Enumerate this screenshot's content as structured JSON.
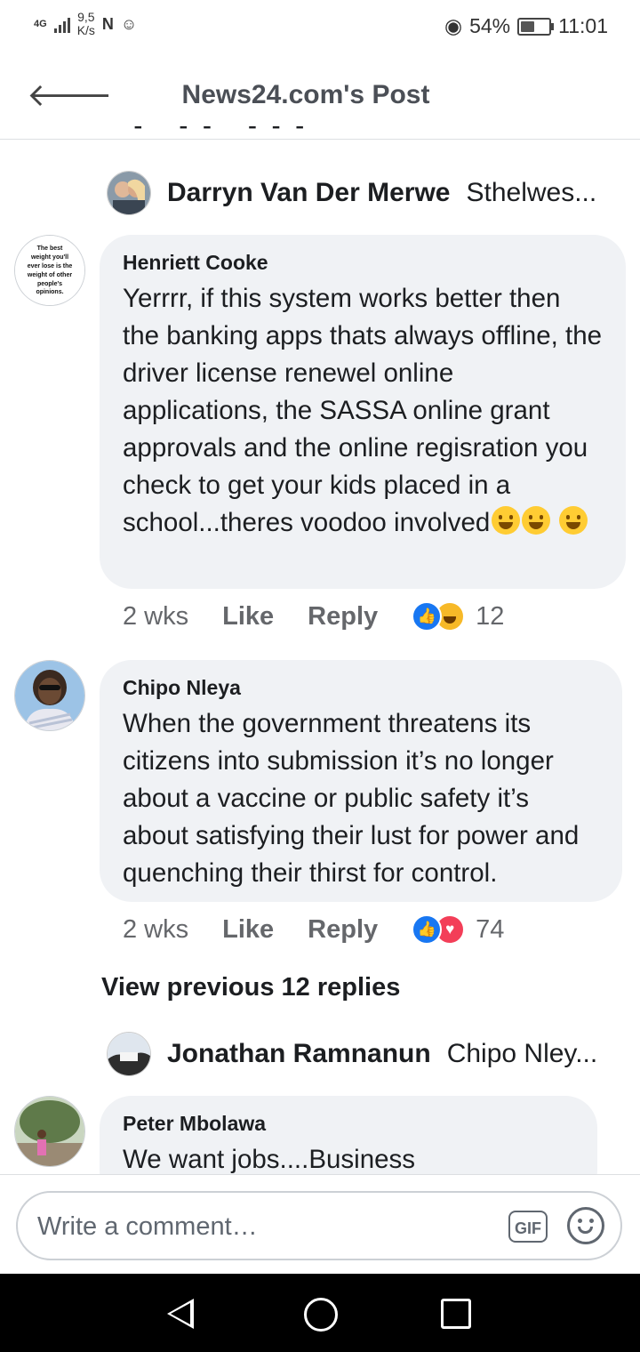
{
  "status_bar": {
    "network": "4G",
    "speed_value": "9,5",
    "speed_unit": "K/s",
    "battery": "54%",
    "battery_level": 0.54,
    "time": "11:01"
  },
  "header": {
    "title": "News24.com's Post"
  },
  "nested_replies": [
    {
      "name": "Darryn Van Der Merwe",
      "text": "Sthelwes..."
    },
    {
      "name": "Jonathan Ramnanun",
      "text": "Chipo Nley..."
    }
  ],
  "comments": [
    {
      "author": "Henriett Cooke",
      "avatar_text": "The best weight you'll ever lose is the weight of other people's opinions.",
      "text": "Yerrrr, if this system works better then the banking apps thats always offline, the driver license renewel online applications, the SASSA online grant approvals and the online regisration you check to get your kids placed in a school...theres voodoo involved",
      "time": "2 wks",
      "like": "Like",
      "reply": "Reply",
      "reactions": [
        "like",
        "haha"
      ],
      "reaction_count": "12"
    },
    {
      "author": "Chipo Nleya",
      "text": "When the government threatens its citizens into submission it’s no longer about a vaccine or public safety it’s about satisfying their lust for power and quenching their thirst for control.",
      "time": "2 wks",
      "like": "Like",
      "reply": "Reply",
      "reactions": [
        "like",
        "love"
      ],
      "reaction_count": "74"
    },
    {
      "author": "Peter Mbolawa",
      "text": "We want jobs....Business"
    }
  ],
  "view_previous": "View previous 12 replies",
  "composer": {
    "placeholder": "Write a comment…",
    "gif_label": "GIF"
  },
  "colors": {
    "bubble": "#f0f2f5",
    "like_blue": "#1877f2",
    "love_red": "#f33e58",
    "haha_yellow": "#f7b928"
  }
}
